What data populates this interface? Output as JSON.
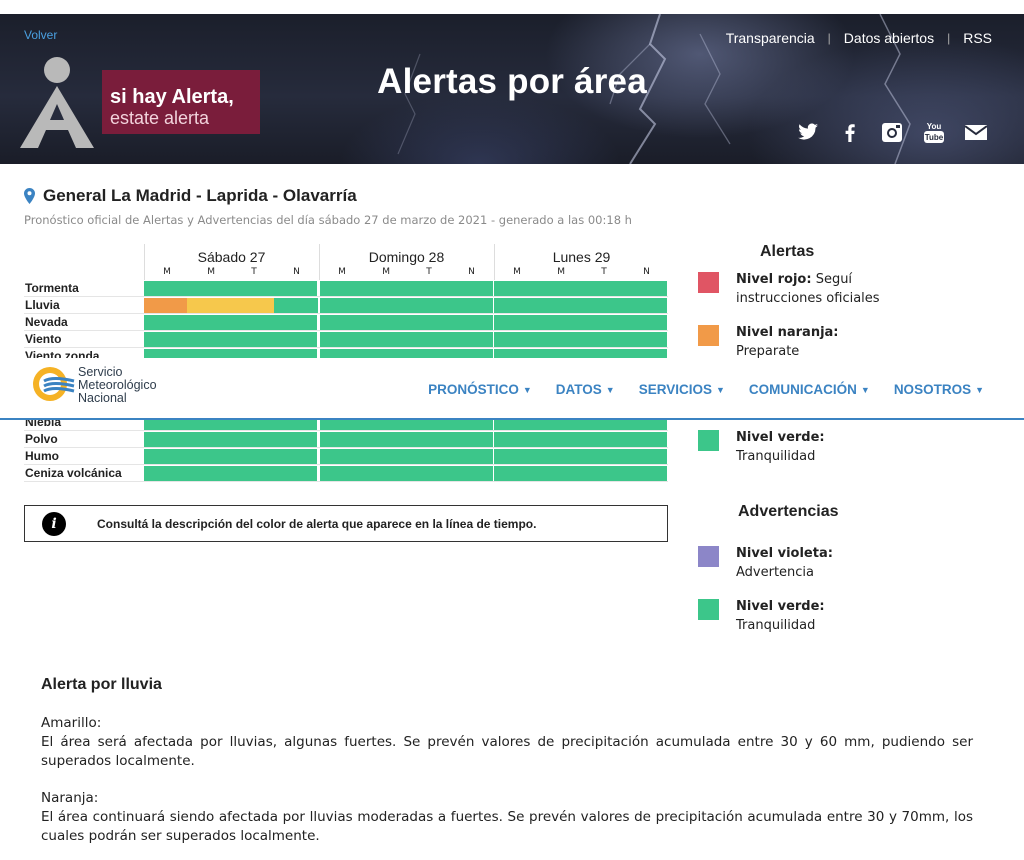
{
  "header": {
    "back_label": "Volver",
    "title": "Alertas por área",
    "badge_line1": "si hay Alerta,",
    "badge_line2": "estate alerta",
    "top_links": [
      "Transparencia",
      "Datos abiertos",
      "RSS"
    ],
    "social_icons": [
      "twitter-icon",
      "facebook-icon",
      "instagram-icon",
      "youtube-icon",
      "mail-icon"
    ]
  },
  "location": {
    "title": "General La Madrid - Laprida - Olavarría",
    "subtitle": "Pronóstico oficial de Alertas y Advertencias del día sábado 27 de marzo de 2021 - generado a las 00:18 h"
  },
  "grid": {
    "days": [
      {
        "name": "Sábado 27",
        "slots": [
          "M",
          "M",
          "T",
          "N"
        ]
      },
      {
        "name": "Domingo 28",
        "slots": [
          "M",
          "M",
          "T",
          "N"
        ]
      },
      {
        "name": "Lunes 29",
        "slots": [
          "M",
          "M",
          "T",
          "N"
        ]
      }
    ],
    "rows": [
      "Tormenta",
      "Lluvia",
      "Nevada",
      "Viento",
      "Viento zonda",
      "Nieblа",
      "Polvo",
      "Humo",
      "Ceniza volcánica"
    ],
    "colors": {
      "green": "#3cc68a",
      "orange": "#f19a48",
      "yellow": "#f6c84c"
    },
    "lluvia_sabado": [
      "orange",
      "yellow",
      "yellow",
      "green"
    ]
  },
  "nav": {
    "logo_text": [
      "Servicio",
      "Meteorológico",
      "Nacional"
    ],
    "items": [
      "PRONÓSTICO",
      "DATOS",
      "SERVICIOS",
      "COMUNICACIÓN",
      "NOSOTROS"
    ]
  },
  "info": {
    "text": "Consultá la descripción del color de alerta que aparece en la línea de tiempo."
  },
  "legend": {
    "alerts_title": "Alertas",
    "advert_title": "Advertencias",
    "alerts": [
      {
        "level": "Nivel rojo:",
        "desc": "Seguí instrucciones oficiales",
        "color": "#e05564"
      },
      {
        "level": "Nivel naranja:",
        "desc": "Preparate",
        "color": "#f19a48"
      },
      {
        "level": "Nivel verde:",
        "desc": "Tranquilidad",
        "color": "#3cc68a"
      }
    ],
    "advertencias": [
      {
        "level": "Nivel violeta:",
        "desc": "Advertencia",
        "color": "#8c86c8"
      },
      {
        "level": "Nivel verde:",
        "desc": "Tranquilidad",
        "color": "#3cc68a"
      }
    ]
  },
  "article": {
    "title": "Alerta por lluvia",
    "sections": [
      {
        "label": "Amarillo:",
        "text": "El área será afectada por lluvias, algunas fuertes. Se prevén valores de precipitación acumulada entre 30 y 60 mm, pudiendo ser superados localmente."
      },
      {
        "label": "Naranja:",
        "text": "El área continuará siendo afectada por lluvias moderadas a fuertes. Se prevén valores de precipitación acumulada entre 30 y 70mm, los cuales podrán ser superados localmente."
      }
    ]
  }
}
